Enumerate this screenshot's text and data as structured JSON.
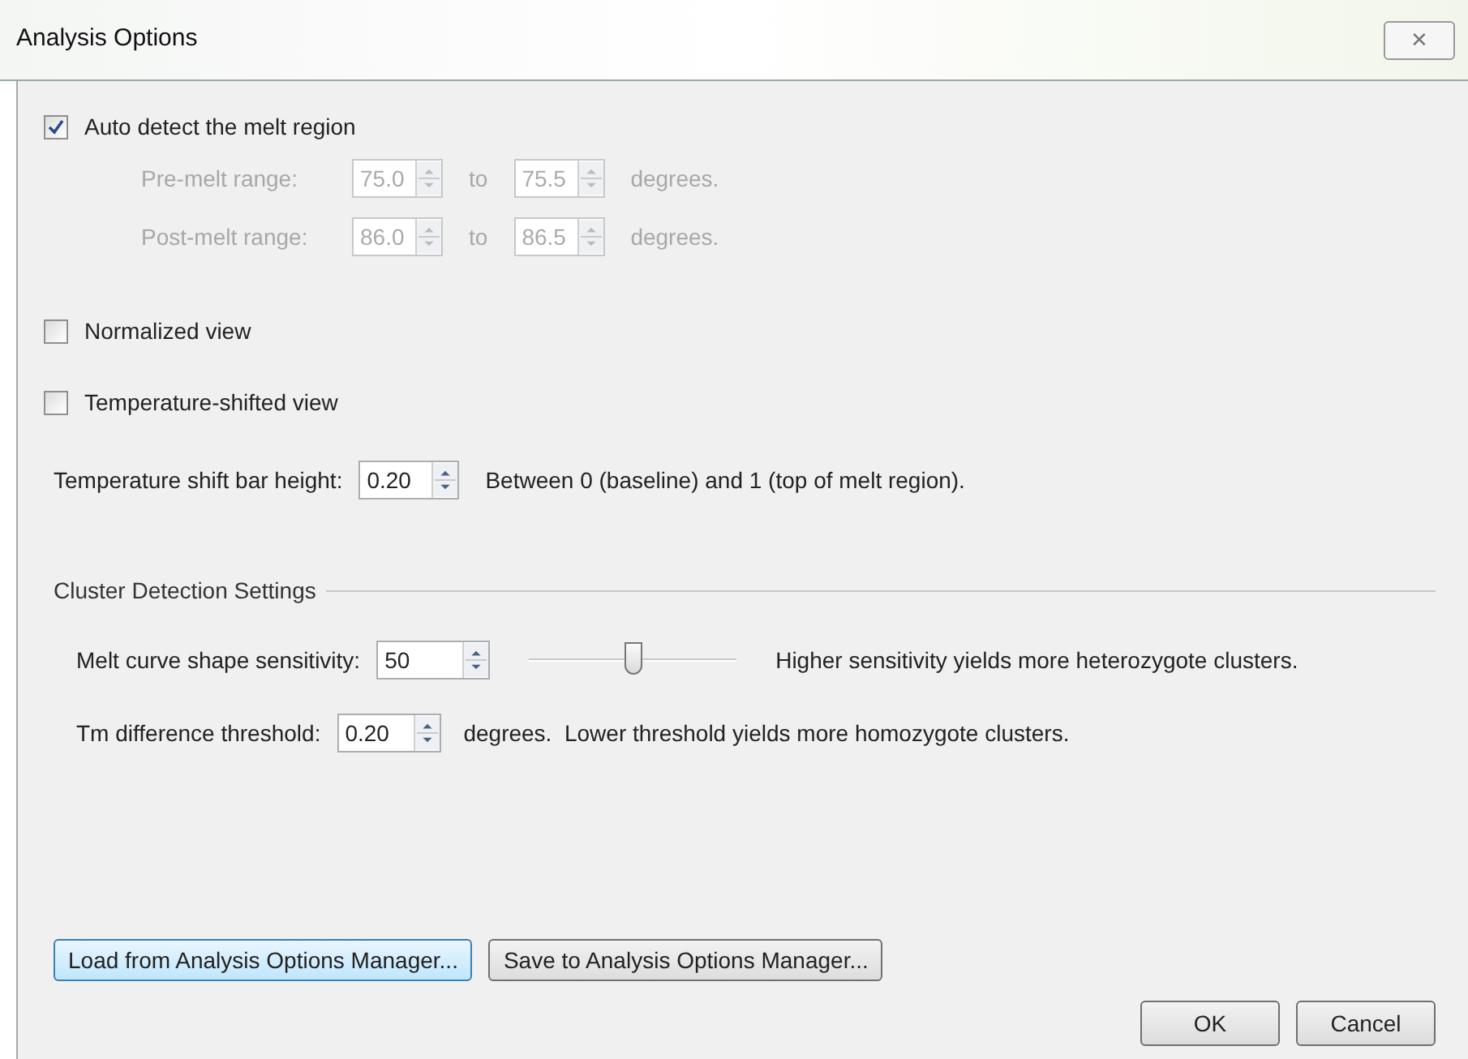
{
  "window": {
    "title": "Analysis Options",
    "close": "✕"
  },
  "auto_detect": {
    "label": "Auto detect the melt region",
    "checked": true
  },
  "ranges": [
    {
      "label": "Pre-melt range:",
      "from": "75.0",
      "to_label": "to",
      "to": "75.5",
      "unit": "degrees.",
      "disabled": true
    },
    {
      "label": "Post-melt range:",
      "from": "86.0",
      "to_label": "to",
      "to": "86.5",
      "unit": "degrees.",
      "disabled": true
    }
  ],
  "view_options": [
    {
      "label": "Normalized view",
      "checked": false
    },
    {
      "label": "Temperature-shifted view",
      "checked": false
    }
  ],
  "shift_bar": {
    "label": "Temperature shift bar height:",
    "value": "0.20",
    "note": "Between 0 (baseline) and 1 (top of melt region)."
  },
  "cluster": {
    "title": "Cluster Detection Settings",
    "sensitivity": {
      "label": "Melt curve shape sensitivity:",
      "value": "50",
      "level": 0.5,
      "note": "Higher sensitivity yields more heterozygote clusters."
    },
    "tm": {
      "label": "Tm difference threshold:",
      "value": "0.20",
      "note": "degrees.  Lower threshold yields more homozygote clusters."
    }
  },
  "manager_buttons": [
    {
      "label": "Load from Analysis Options Manager...",
      "focused": true
    },
    {
      "label": "Save to Analysis Options Manager...",
      "focused": false
    }
  ],
  "dialog_buttons": [
    "OK",
    "Cancel"
  ]
}
